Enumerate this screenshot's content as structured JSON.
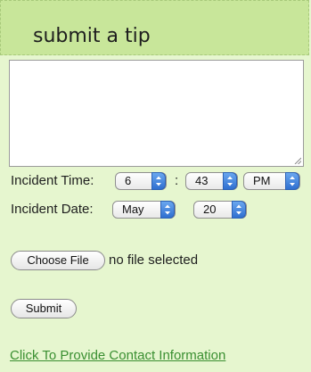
{
  "header": {
    "title": "submit a tip"
  },
  "tip_textarea": {
    "value": ""
  },
  "incident_time": {
    "label": "Incident Time:",
    "hour": "6",
    "separator": ":",
    "minute": "43",
    "ampm": "PM"
  },
  "incident_date": {
    "label": "Incident Date:",
    "month": "May",
    "day": "20"
  },
  "file_upload": {
    "button_label": "Choose File",
    "status": "no file selected"
  },
  "submit_label": "Submit",
  "contact_link": "Click To Provide Contact Information",
  "colors": {
    "background": "#e6f6cf",
    "header_background": "#c8e69a",
    "link": "#3a8f31",
    "select_arrow": "#3f7fdc"
  }
}
